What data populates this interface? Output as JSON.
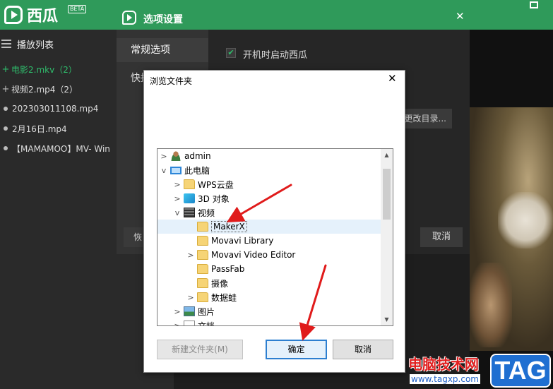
{
  "app": {
    "name": "西瓜",
    "badge": "BETA",
    "titlebar_dash": "-",
    "playlist": {
      "title": "播放列表",
      "items": [
        {
          "mark": "+",
          "label": "电影2.mkv（2）",
          "active": true
        },
        {
          "mark": "+",
          "label": "视频2.mp4（2）",
          "active": false
        },
        {
          "mark": "•",
          "label": "202303011108.mp4",
          "active": false
        },
        {
          "mark": "•",
          "label": "2月16日.mp4",
          "active": false
        },
        {
          "mark": "•",
          "label": "【MAMAMOO】MV- Win",
          "active": false
        }
      ]
    }
  },
  "settings": {
    "title": "选项设置",
    "close": "✕",
    "nav": [
      "常规选项",
      "快捷"
    ],
    "startup_checked": true,
    "startup_label": "开机时启动西瓜",
    "change_dir": "更改目录...",
    "restore": "恢",
    "cancel": "取消"
  },
  "browse": {
    "title": "浏览文件夹",
    "close": "✕",
    "tree": [
      {
        "chev": ">",
        "icon": "user-icon",
        "label": "admin",
        "level": 0
      },
      {
        "chev": "v",
        "icon": "pc-icon",
        "label": "此电脑",
        "level": 0
      },
      {
        "chev": ">",
        "icon": "folder-icon",
        "label": "WPS云盘",
        "level": 1
      },
      {
        "chev": ">",
        "icon": "cube-icon",
        "label": "3D 对象",
        "level": 1
      },
      {
        "chev": "v",
        "icon": "film-icon",
        "label": "视频",
        "level": 1
      },
      {
        "chev": "",
        "icon": "folder-icon",
        "label": "MakerX",
        "level": 2,
        "selected": true
      },
      {
        "chev": "",
        "icon": "folder-icon",
        "label": "Movavi Library",
        "level": 2
      },
      {
        "chev": ">",
        "icon": "folder-icon",
        "label": "Movavi Video Editor",
        "level": 2
      },
      {
        "chev": "",
        "icon": "folder-icon",
        "label": "PassFab",
        "level": 2
      },
      {
        "chev": "",
        "icon": "folder-icon",
        "label": "摄像",
        "level": 2
      },
      {
        "chev": ">",
        "icon": "folder-icon",
        "label": "数据蛙",
        "level": 2
      },
      {
        "chev": ">",
        "icon": "picture-icon",
        "label": "图片",
        "level": 1
      },
      {
        "chev": ">",
        "icon": "document-icon",
        "label": "文档",
        "level": 1
      }
    ],
    "new_folder": "新建文件夹(M)",
    "ok": "确定",
    "cancel": "取消"
  },
  "watermark": {
    "text": "电脑技术网",
    "url": "www.tagxp.com",
    "tag": "TAG"
  },
  "colors": {
    "brand_green": "#2f9a5a",
    "active_green": "#2fbd6c",
    "arrow_red": "#e01b1b"
  }
}
